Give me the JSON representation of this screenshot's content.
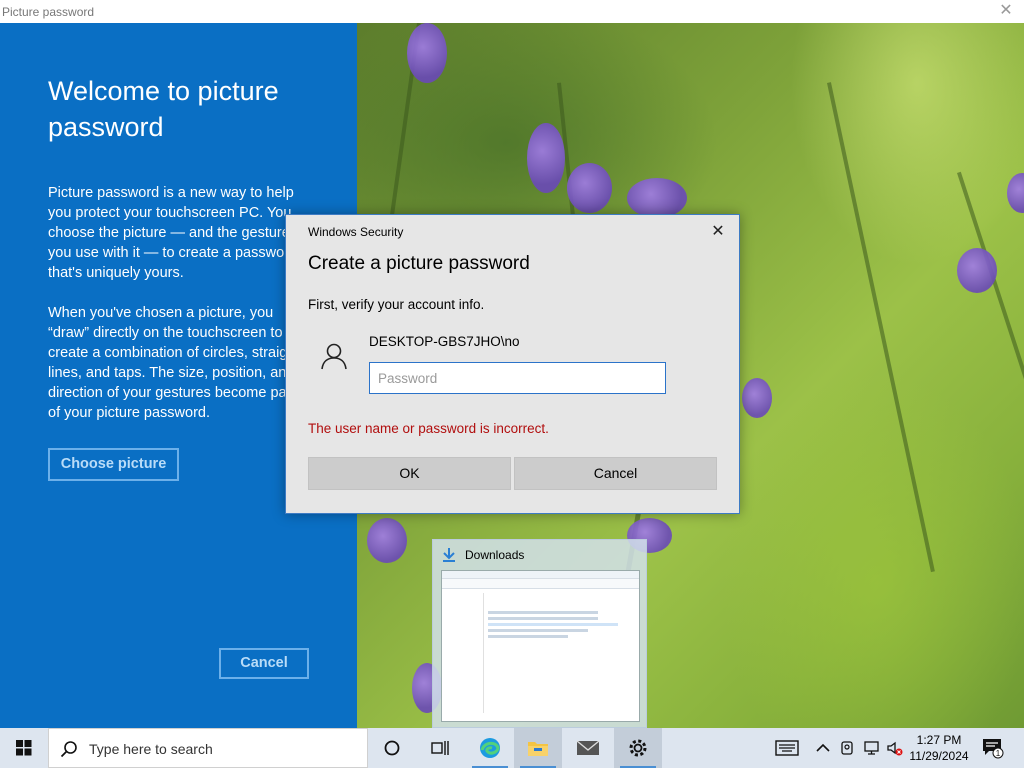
{
  "window": {
    "title": "Picture password",
    "close_glyph": "✕"
  },
  "left_panel": {
    "heading_line1": "Welcome to picture",
    "heading_line2": "password",
    "para1": [
      "Picture password is a new way to help",
      "you protect your touchscreen PC. You",
      "choose the picture — and the gesture",
      "you use with it — to create a passwor",
      "that's uniquely yours."
    ],
    "para2": [
      "When you've chosen a picture, you",
      "“draw” directly on the touchscreen to",
      "create a combination of circles, straigh",
      "lines, and taps. The size, position, and",
      "direction of your gestures become pa",
      "of your picture password."
    ],
    "choose_button": "Choose picture",
    "cancel_button": "Cancel",
    "background": "#0a6fc4"
  },
  "dialog": {
    "caption": "Windows Security",
    "title": "Create a picture password",
    "subtitle": "First, verify your account info.",
    "account": "DESKTOP-GBS7JHO\\no",
    "password_value": "",
    "password_placeholder": "Password",
    "error": "The user name or password is incorrect.",
    "ok_button": "OK",
    "cancel_button": "Cancel",
    "user_icon": "user-icon",
    "error_color": "#b10e0e"
  },
  "thumbnail": {
    "label": "Downloads",
    "icon": "download-arrow-icon"
  },
  "taskbar": {
    "search_placeholder": "Type here to search",
    "apps": [
      {
        "name": "cortana",
        "icon": "cortana-circle-icon"
      },
      {
        "name": "task-view",
        "icon": "task-view-icon"
      },
      {
        "name": "edge",
        "icon": "edge-icon"
      },
      {
        "name": "file-explorer",
        "icon": "folder-icon"
      },
      {
        "name": "mail",
        "icon": "mail-icon"
      },
      {
        "name": "settings",
        "icon": "gear-icon"
      }
    ],
    "tray_icons": [
      "keyboard-icon",
      "chevron-up-icon",
      "meet-now-icon",
      "network-icon",
      "volume-muted-icon"
    ],
    "time": "1:27 PM",
    "date": "11/29/2024",
    "notification_count": "1"
  }
}
